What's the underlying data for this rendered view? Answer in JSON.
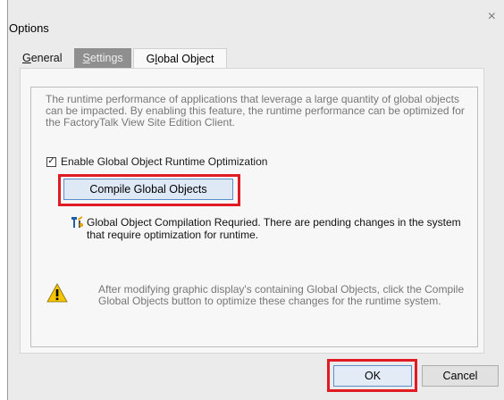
{
  "dialog": {
    "title": "Options",
    "close_glyph": "×"
  },
  "tabs": [
    {
      "label_underline": "G",
      "label_rest": "eneral"
    },
    {
      "label_underline": "S",
      "label_rest": "ettings"
    },
    {
      "label_pre": "G",
      "label_underline": "l",
      "label_rest": "obal Object"
    }
  ],
  "panel": {
    "description": "The runtime performance of applications that leverage a large quantity of global objects can be impacted. By enabling this feature, the runtime performance can be optimized for the FactoryTalk View Site Edition Client.",
    "checkbox_label": "Enable Global Object Runtime Optimization",
    "checkbox_checked_glyph": "✓",
    "compile_button_label": "Compile Global Objects",
    "pending_message": "Global Object Compilation Requried. There are pending changes in the system that require optimization for runtime.",
    "warning_message": "After modifying graphic display's containing Global Objects, click the Compile Global Objects button to optimize these changes for the runtime system."
  },
  "footer": {
    "ok_label": "OK",
    "cancel_label": "Cancel"
  },
  "colors": {
    "highlight": "#e01b24",
    "warning_yellow": "#f5c400"
  }
}
